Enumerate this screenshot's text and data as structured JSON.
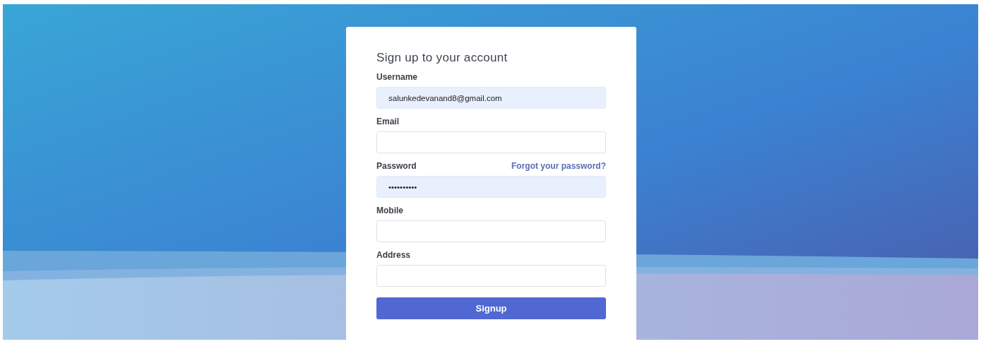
{
  "form": {
    "title": "Sign up to your account",
    "fields": [
      {
        "label": "Username",
        "value": "salunkedevanand8@gmail.com",
        "autofilled": true
      },
      {
        "label": "Email",
        "autofilled": false
      },
      {
        "label": "Password",
        "value": "••••••••••",
        "autofilled": true,
        "link": "Forgot your password?"
      },
      {
        "label": "Mobile",
        "autofilled": false
      },
      {
        "label": "Address",
        "autofilled": false
      }
    ],
    "submit": "Signup"
  }
}
